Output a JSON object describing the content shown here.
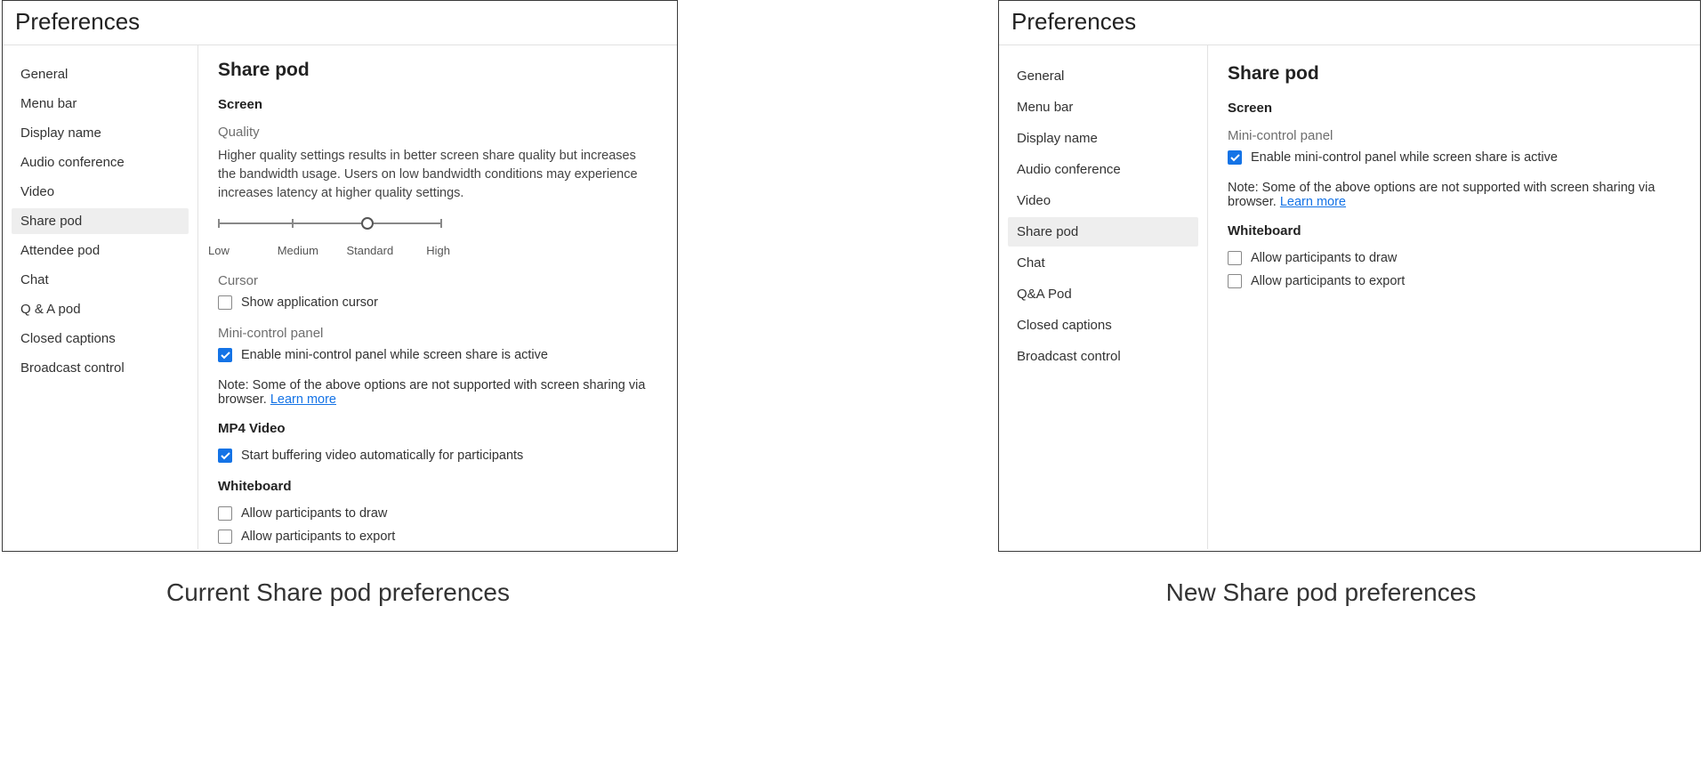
{
  "captions": {
    "left": "Current Share pod preferences",
    "right": "New Share pod preferences"
  },
  "left": {
    "title": "Preferences",
    "sidebar": [
      "General",
      "Menu bar",
      "Display name",
      "Audio conference",
      "Video",
      "Share pod",
      "Attendee pod",
      "Chat",
      "Q & A pod",
      "Closed captions",
      "Broadcast control"
    ],
    "content": {
      "heading": "Share pod",
      "screen_heading": "Screen",
      "quality_heading": "Quality",
      "quality_desc": "Higher quality settings results in better screen share quality but increases the bandwidth usage. Users on low bandwidth conditions may experience increases latency at higher quality settings.",
      "slider_labels": [
        "Low",
        "Medium",
        "Standard",
        "High"
      ],
      "cursor_heading": "Cursor",
      "cursor_cb": "Show application cursor",
      "mini_heading": "Mini-control panel",
      "mini_cb": "Enable mini-control panel while screen share is active",
      "note_prefix": "Note: Some of the above options are not supported with screen sharing via browser. ",
      "note_link": "Learn more",
      "mp4_heading": "MP4 Video",
      "mp4_cb": "Start buffering video automatically for participants",
      "wb_heading": "Whiteboard",
      "wb_draw": "Allow participants to draw",
      "wb_export": "Allow participants to export"
    }
  },
  "right": {
    "title": "Preferences",
    "sidebar": [
      "General",
      "Menu bar",
      "Display name",
      "Audio conference",
      "Video",
      "Share pod",
      "Chat",
      "Q&A Pod",
      "Closed captions",
      "Broadcast control"
    ],
    "content": {
      "heading": "Share pod",
      "screen_heading": "Screen",
      "mini_heading": "Mini-control panel",
      "mini_cb": "Enable mini-control panel while screen share is active",
      "note_prefix": "Note: Some of the above options are not supported with screen sharing via browser. ",
      "note_link": "Learn more",
      "wb_heading": "Whiteboard",
      "wb_draw": "Allow participants to draw",
      "wb_export": "Allow participants to export"
    }
  }
}
